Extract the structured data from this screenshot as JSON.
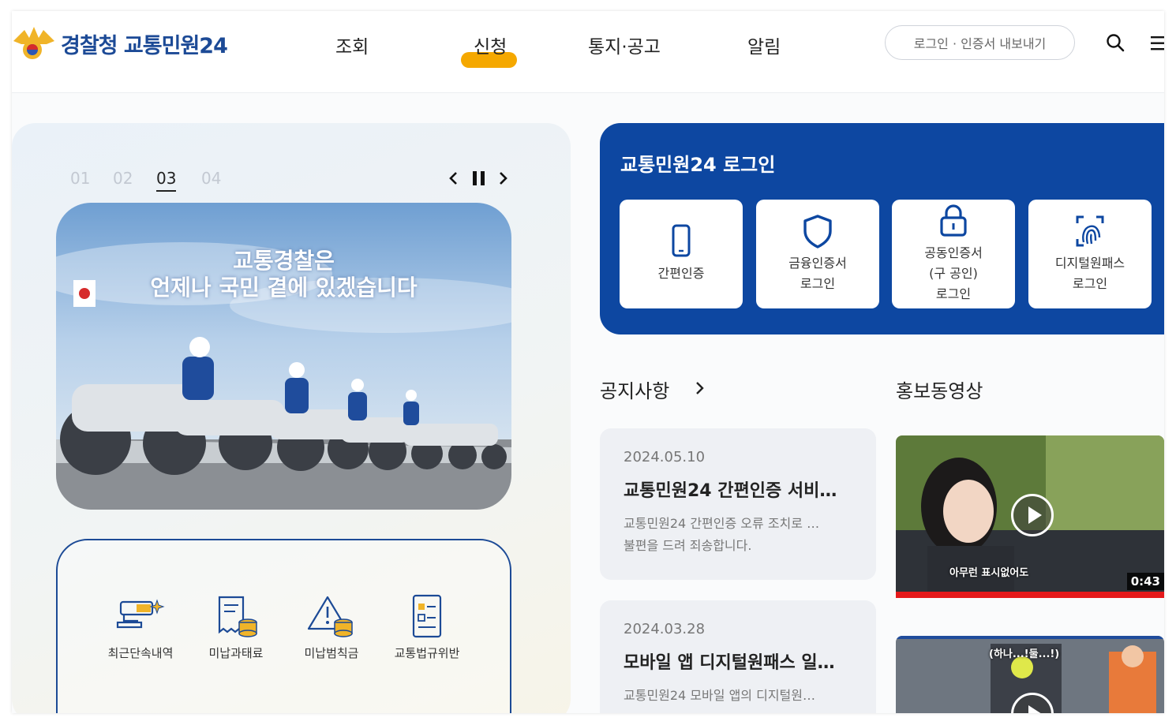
{
  "header": {
    "logo_text": "경찰청 교통민원24",
    "nav": [
      {
        "label": "조회"
      },
      {
        "label": "신청"
      },
      {
        "label": "통지·공고"
      },
      {
        "label": "알림"
      }
    ],
    "login_pill": "로그인 · 인증서 내보내기",
    "search_icon": "search-icon",
    "menu_icon": "hamburger-menu-icon",
    "accent_color": "#f5a800"
  },
  "slider": {
    "numbers": [
      "01",
      "02",
      "03",
      "04"
    ],
    "active_index": 2,
    "banner_line1": "교통경찰은",
    "banner_line2": "언제나 국민 곁에 있겠습니다"
  },
  "quick_menu": [
    {
      "label": "최근단속내역",
      "icon": "cctv-camera-icon"
    },
    {
      "label": "미납과태료",
      "icon": "receipt-coins-icon"
    },
    {
      "label": "미납범칙금",
      "icon": "warning-coins-icon"
    },
    {
      "label": "교통법규위반",
      "icon": "checklist-document-icon"
    }
  ],
  "login": {
    "title": "교통민원24 로그인",
    "panel_color": "#0d47a1",
    "options": [
      {
        "label": "간편인증",
        "icon": "smartphone-icon"
      },
      {
        "label": "금융인증서\n로그인",
        "icon": "shield-icon"
      },
      {
        "label": "공동인증서\n(구 공인)\n로그인",
        "icon": "lock-icon"
      },
      {
        "label": "디지털원패스\n로그인",
        "icon": "fingerprint-icon"
      }
    ]
  },
  "notices": {
    "title": "공지사항",
    "items": [
      {
        "date": "2024.05.10",
        "title": "교통민원24 간편인증 서비…",
        "body": "교통민원24 간편인증 오류 조치로 …\n불편을 드려 죄송합니다."
      },
      {
        "date": "2024.03.28",
        "title": "모바일 앱 디지털원패스 일…",
        "body": "교통민원24 모바일 앱의 디지털원…"
      }
    ]
  },
  "videos": {
    "title": "홍보동영상",
    "items": [
      {
        "caption": "아무런 표시없어도",
        "duration": "0:43"
      },
      {
        "caption": "(하나...!둘...!)"
      }
    ]
  }
}
